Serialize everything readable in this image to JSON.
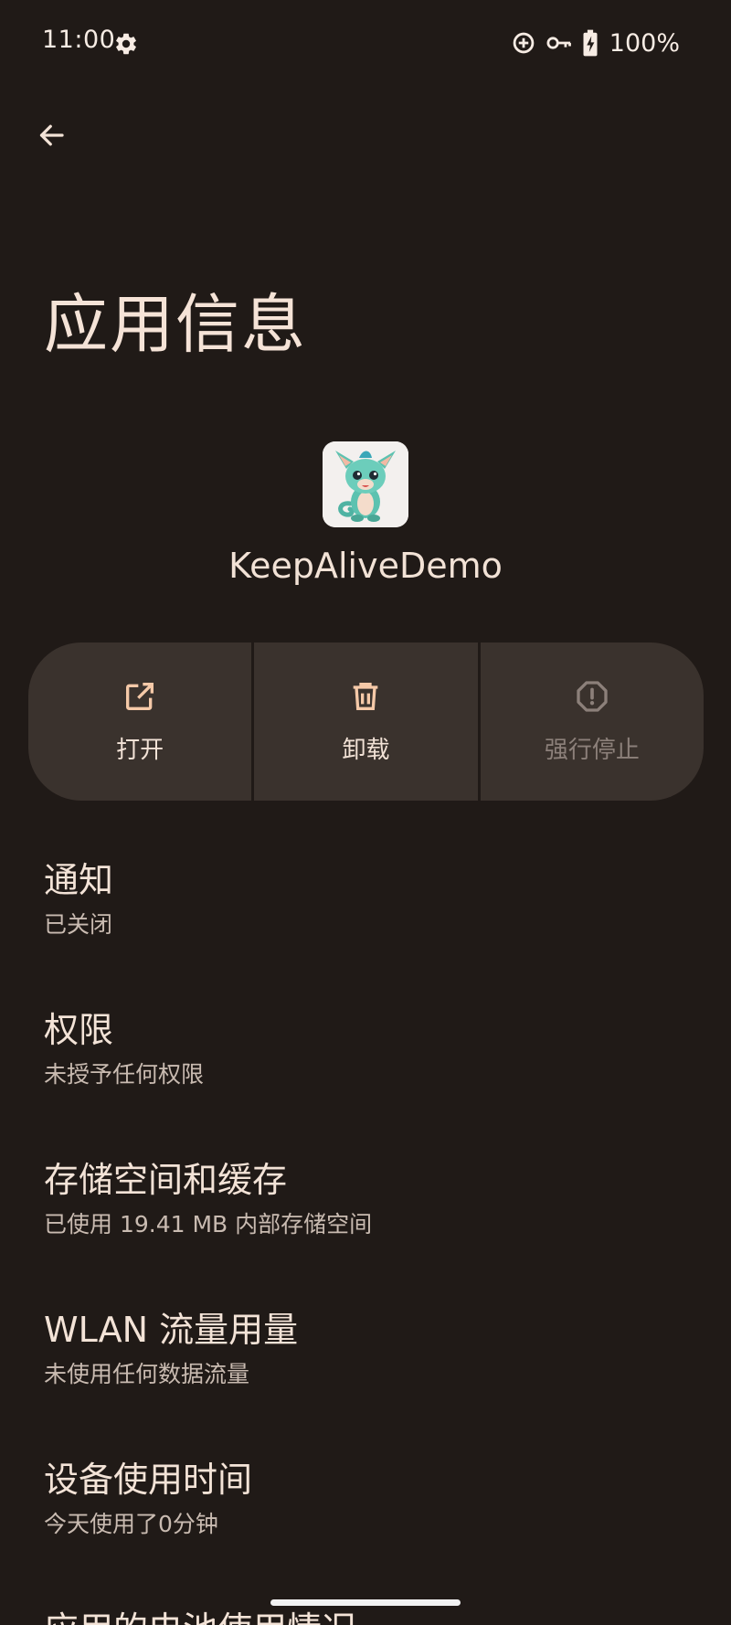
{
  "status_bar": {
    "time": "11:00",
    "battery_percent": "100%",
    "icons": [
      "gear-icon",
      "data-saver-icon",
      "vpn-key-icon",
      "battery-charging-icon"
    ]
  },
  "header": {
    "back_icon": "arrow-left-icon",
    "title": "应用信息"
  },
  "app": {
    "name": "KeepAliveDemo",
    "icon": "dragon-app-icon"
  },
  "actions": [
    {
      "label": "打开",
      "icon": "open-external-icon",
      "enabled": true
    },
    {
      "label": "卸载",
      "icon": "trash-icon",
      "enabled": true
    },
    {
      "label": "强行停止",
      "icon": "alert-circle-icon",
      "enabled": false
    }
  ],
  "settings": [
    {
      "title": "通知",
      "summary": "已关闭"
    },
    {
      "title": "权限",
      "summary": "未授予任何权限"
    },
    {
      "title": "存储空间和缓存",
      "summary": "已使用 19.41 MB 内部存储空间"
    },
    {
      "title": "WLAN 流量用量",
      "summary": "未使用任何数据流量"
    },
    {
      "title": "设备使用时间",
      "summary": "今天使用了0分钟"
    },
    {
      "title": "应用的电池使用情况",
      "summary": ""
    }
  ],
  "colors": {
    "background": "#201a17",
    "button_bg": "#3a322d",
    "text_primary": "#f3e3d7",
    "text_secondary": "#c9bbb1",
    "text_disabled": "#8c807a"
  }
}
